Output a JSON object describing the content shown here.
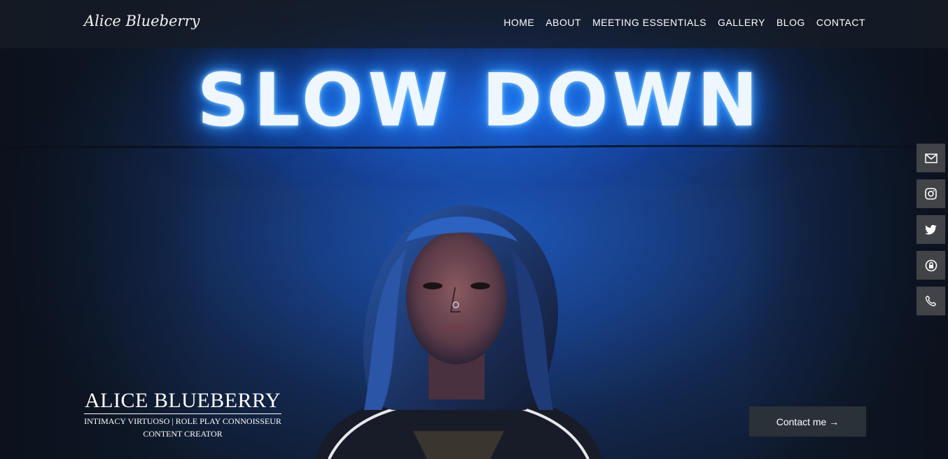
{
  "brand": {
    "logo_text": "Alice Blueberry"
  },
  "nav": {
    "items": [
      {
        "label": "HOME"
      },
      {
        "label": "ABOUT"
      },
      {
        "label": "MEETING ESSENTIALS"
      },
      {
        "label": "GALLERY"
      },
      {
        "label": "BLOG"
      },
      {
        "label": "CONTACT"
      }
    ]
  },
  "hero": {
    "sign_text": "SLOW DOWN",
    "name": "ALICE BLUEBERRY",
    "tagline_line1": "INTIMACY VIRTUOSO | ROLE PLAY CONNOISSEUR",
    "tagline_line2": "CONTENT CREATOR",
    "cta_label": "Contact me →"
  },
  "social": {
    "icons": [
      "email-icon",
      "instagram-icon",
      "twitter-icon",
      "onlyfans-icon",
      "phone-icon"
    ]
  },
  "colors": {
    "neon": "#3aa2ff",
    "button_bg": "#2a3138",
    "social_bg": "#46484c"
  }
}
